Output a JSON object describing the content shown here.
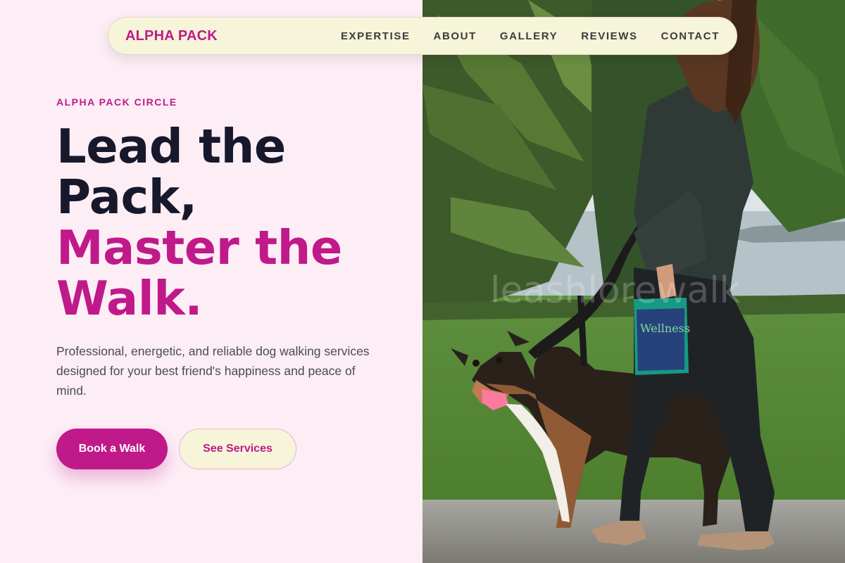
{
  "nav": {
    "brand": "ALPHA PACK",
    "links": [
      "EXPERTISE",
      "ABOUT",
      "GALLERY",
      "REVIEWS",
      "CONTACT"
    ]
  },
  "hero": {
    "eyebrow": "ALPHA PACK CIRCLE",
    "headline_dark": [
      "Lead the",
      "Pack,"
    ],
    "headline_accent": [
      "Master the",
      "Walk."
    ],
    "subtitle": "Professional, energetic, and reliable dog walking services designed for your best friend's happiness and peace of mind.",
    "primary_button": "Book a Walk",
    "secondary_button": "See Services"
  },
  "image": {
    "watermark": "leashlorewalk",
    "bag_label": "Wellness"
  },
  "colors": {
    "accent": "#c0198a",
    "dark": "#17182b",
    "cream": "#f6f4d9",
    "background": "#fdeef6"
  }
}
